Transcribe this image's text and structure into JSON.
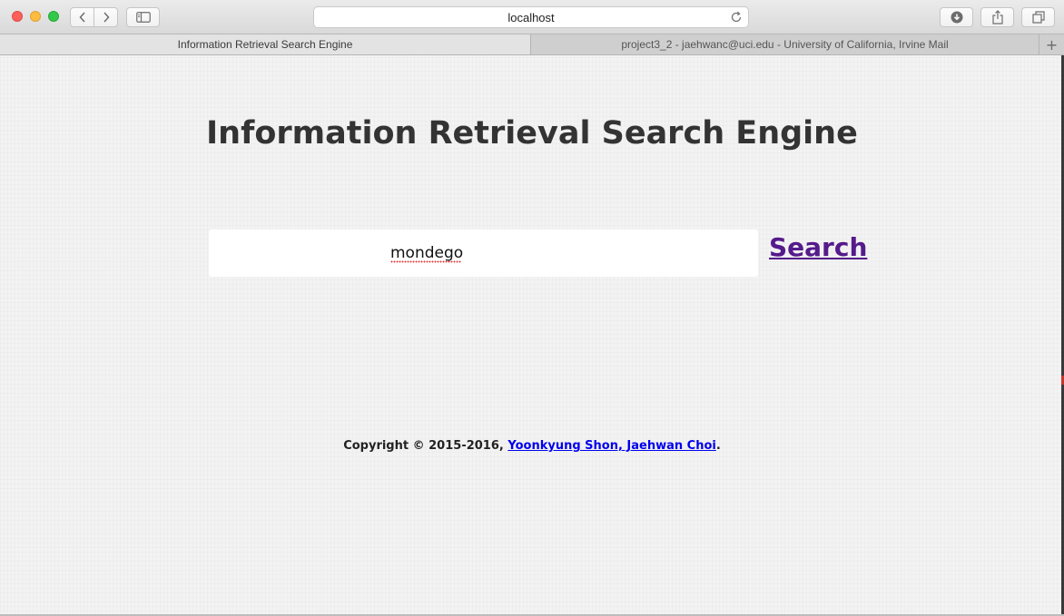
{
  "browser": {
    "address": "localhost",
    "tabs": [
      {
        "label": "Information Retrieval Search Engine",
        "active": true
      },
      {
        "label": "project3_2 - jaehwanc@uci.edu - University of California, Irvine Mail",
        "active": false
      }
    ],
    "new_tab_label": "+"
  },
  "page": {
    "title": "Information Retrieval Search Engine",
    "search_value": "mondego",
    "search_label": "Search",
    "footer": {
      "prefix": "Copyright © 2015-2016, ",
      "authors": "Yoonkyung Shon, Jaehwan Choi",
      "suffix": "."
    }
  },
  "colors": {
    "title": "#333333",
    "visited_link": "#551a8b",
    "link": "#0000ee"
  }
}
